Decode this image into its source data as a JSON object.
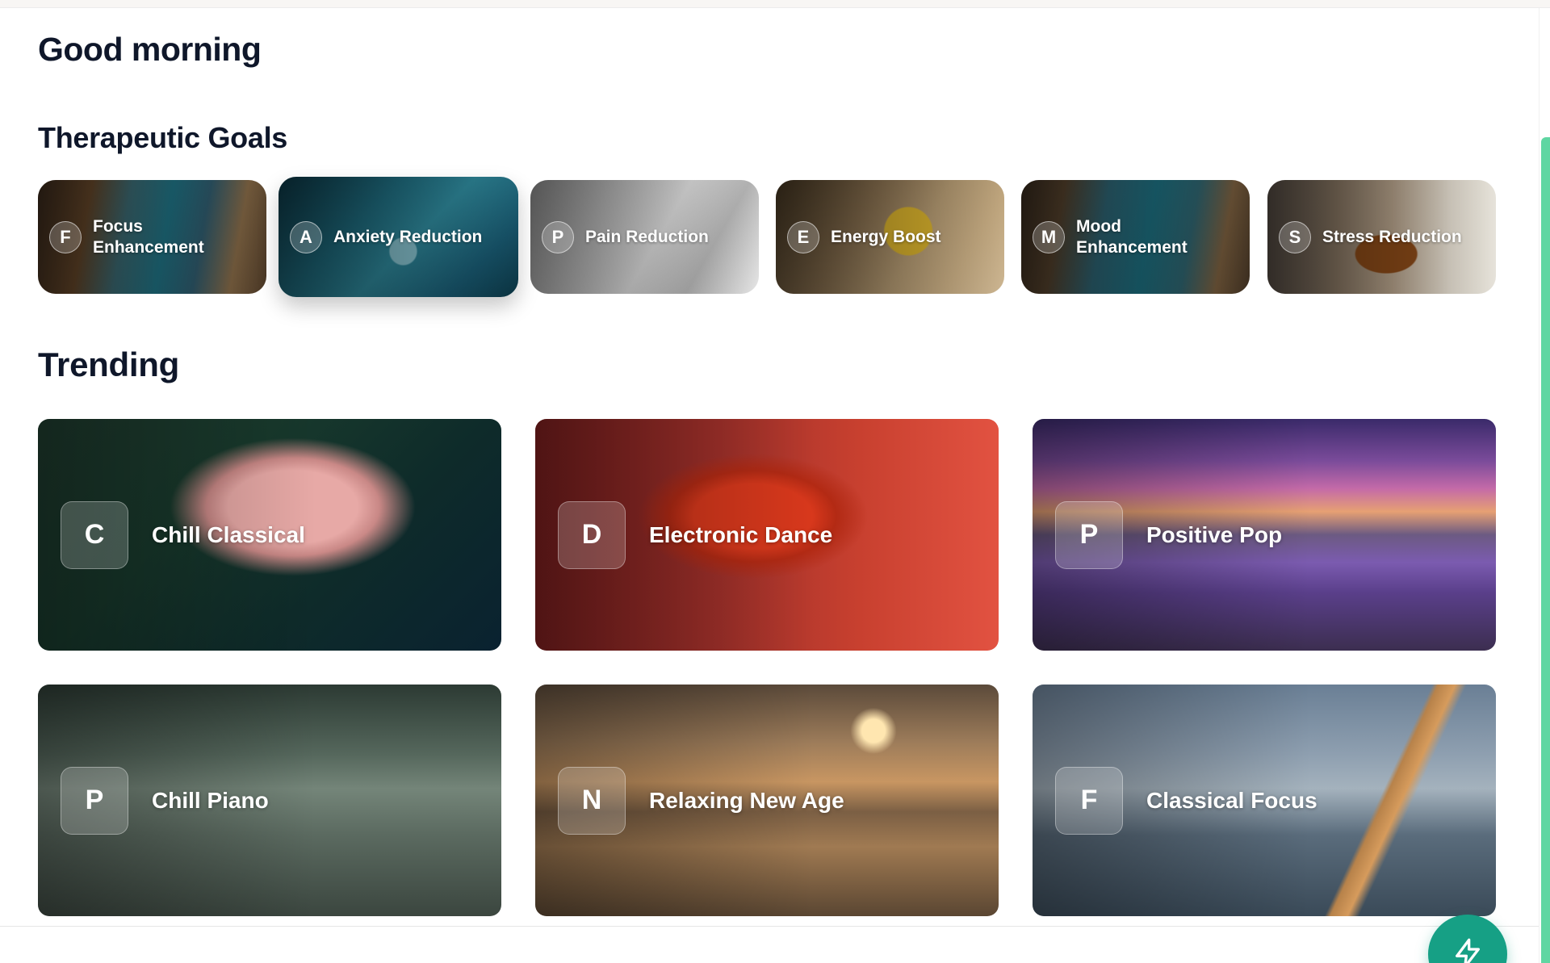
{
  "greeting": "Good morning",
  "goals": {
    "title": "Therapeutic Goals",
    "items": [
      {
        "letter": "F",
        "label": "Focus Enhancement"
      },
      {
        "letter": "A",
        "label": "Anxiety Reduction"
      },
      {
        "letter": "P",
        "label": "Pain Reduction"
      },
      {
        "letter": "E",
        "label": "Energy Boost"
      },
      {
        "letter": "M",
        "label": "Mood Enhancement"
      },
      {
        "letter": "S",
        "label": "Stress Reduction"
      }
    ]
  },
  "trending": {
    "title": "Trending",
    "items": [
      {
        "letter": "C",
        "label": "Chill Classical"
      },
      {
        "letter": "D",
        "label": "Electronic Dance"
      },
      {
        "letter": "P",
        "label": "Positive Pop"
      },
      {
        "letter": "P",
        "label": "Chill Piano"
      },
      {
        "letter": "N",
        "label": "Relaxing New Age"
      },
      {
        "letter": "F",
        "label": "Classical Focus"
      }
    ]
  },
  "fab": {
    "icon": "lightning-icon"
  },
  "colors": {
    "accent": "#16a085",
    "scrollbar": "#5fd6a2"
  }
}
